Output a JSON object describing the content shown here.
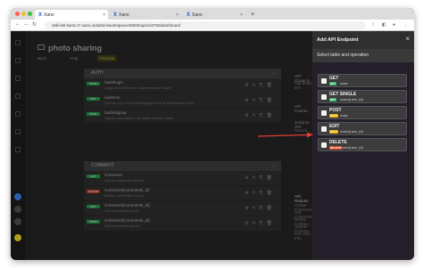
{
  "browser": {
    "tabs": [
      {
        "label": "Xano",
        "active": true
      },
      {
        "label": "Xano",
        "active": false
      },
      {
        "label": "Xano",
        "active": false
      }
    ],
    "new_tab": "+",
    "url": "x8ki-letl-twmt.n7.xano.io/admin/workspace/45693/apis/16759/dashboard",
    "colors": {
      "close": "#ff5f57",
      "minimize": "#febc2e",
      "maximize": "#28c840"
    }
  },
  "page": {
    "title": "photo sharing",
    "back_label": "Back",
    "help_label": "Help",
    "favorite_label": "Favorite"
  },
  "groups": [
    {
      "name": "AUTH",
      "endpoints": [
        {
          "method": "POST",
          "path": "/auth/login",
          "desc": "Login and retrieve an authentication token"
        },
        {
          "method": "GET",
          "path": "/auth/me",
          "desc": "Get the user record belonging to the authentication token"
        },
        {
          "method": "POST",
          "path": "/auth/signup",
          "desc": "Signup and retrieve an authentication token"
        }
      ]
    },
    {
      "name": "COMMENT",
      "endpoints": [
        {
          "method": "GET",
          "path": "/comment",
          "desc": "Get all comment records"
        },
        {
          "method": "DELETE",
          "path": "/comment/{comments_id}",
          "desc": "Delete comments record"
        },
        {
          "method": "GET",
          "path": "/comment/{comments_id}",
          "desc": "Get comments record"
        },
        {
          "method": "POST",
          "path": "/comment/{comments_id}",
          "desc": "Edit comments record"
        }
      ]
    }
  ],
  "right_col": {
    "group_header": "API Group S",
    "group_sub": "http://x8ki-letl-...",
    "connect_header": "API Connec",
    "jump_header": "Jump to API",
    "search_placeholder": "Search...",
    "requests_label": "API Reques",
    "requests_items": [
      "Create Comment",
      "Get Comments",
      "Delete Comme...",
      "Update Comme...",
      "Get User Info"
    ]
  },
  "panel": {
    "title": "Add API Endpoint",
    "close": "×",
    "subheader": "Select table and operation",
    "operations": [
      {
        "name": "GET",
        "method": "GET",
        "path": "/user",
        "method_color": "#2db55d"
      },
      {
        "name": "GET SINGLE",
        "method": "GET",
        "path": "/user/{user_id}",
        "method_color": "#2db55d"
      },
      {
        "name": "POST",
        "method": "POST",
        "path": "/user",
        "method_color": "#e6a700"
      },
      {
        "name": "EDIT",
        "method": "POST",
        "path": "/user/{user_id}",
        "method_color": "#e6a700"
      },
      {
        "name": "DELETE",
        "method": "DELETE",
        "path": "/user/{user_id}",
        "method_color": "#e0432f"
      }
    ]
  },
  "method_colors": {
    "GET": "#2db55d",
    "POST": "#2db55d",
    "DELETE": "#e0432f"
  },
  "annotation": {
    "arrow_color": "#e53935"
  }
}
